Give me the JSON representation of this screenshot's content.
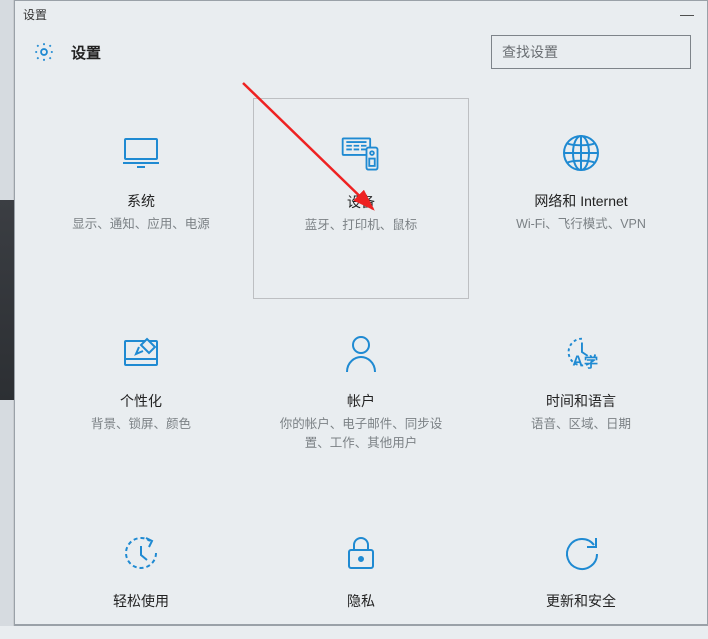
{
  "window_title": "设置",
  "header": {
    "title": "设置"
  },
  "search": {
    "placeholder": "查找设置"
  },
  "tiles": [
    {
      "name": "系统",
      "desc": "显示、通知、应用、电源"
    },
    {
      "name": "设备",
      "desc": "蓝牙、打印机、鼠标"
    },
    {
      "name": "网络和 Internet",
      "desc": "Wi-Fi、飞行模式、VPN"
    },
    {
      "name": "个性化",
      "desc": "背景、锁屏、颜色"
    },
    {
      "name": "帐户",
      "desc": "你的帐户、电子邮件、同步设置、工作、其他用户"
    },
    {
      "name": "时间和语言",
      "desc": "语音、区域、日期"
    },
    {
      "name": "轻松使用",
      "desc": ""
    },
    {
      "name": "隐私",
      "desc": ""
    },
    {
      "name": "更新和安全",
      "desc": ""
    }
  ]
}
